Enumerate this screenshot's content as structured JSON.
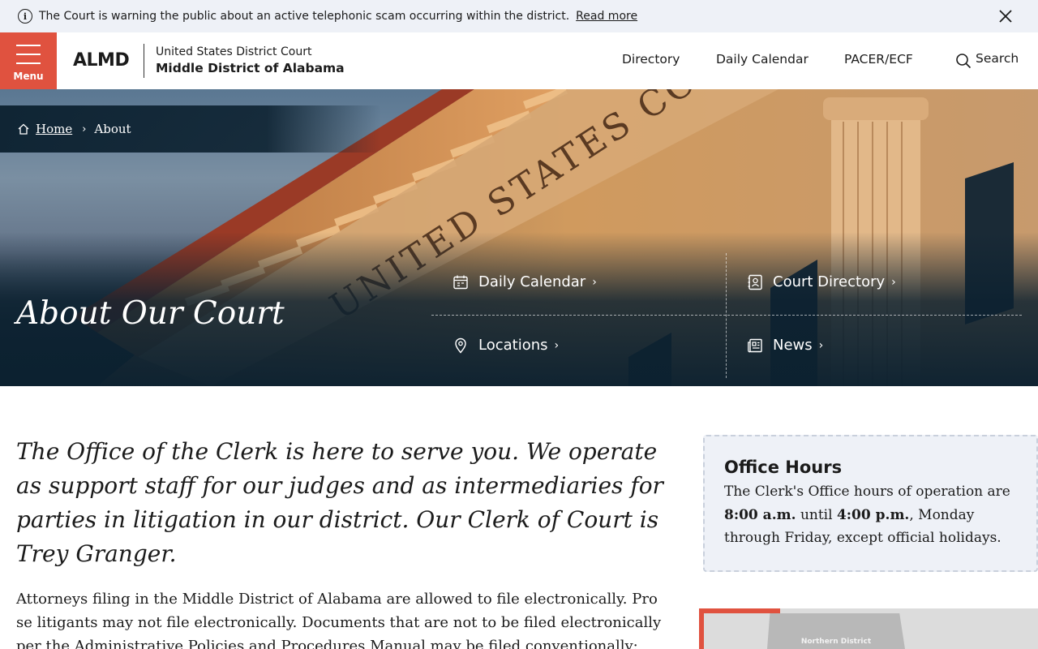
{
  "alert": {
    "message": "The Court is warning the public about an active telephonic scam occurring within the district.",
    "link": "Read more"
  },
  "header": {
    "menu_label": "Menu",
    "logo": "ALMD",
    "court_line1": "United States District Court",
    "court_line2": "Middle District of Alabama",
    "nav": [
      "Directory",
      "Daily Calendar",
      "PACER/ECF"
    ],
    "search_label": "Search"
  },
  "hero": {
    "breadcrumb": {
      "home": "Home",
      "current": "About"
    },
    "title": "About Our Court",
    "building_text": "UNITED STATES COURT HOUSE",
    "quick_links": [
      {
        "label": "Daily Calendar",
        "icon": "calendar-icon"
      },
      {
        "label": "Court Directory",
        "icon": "contact-book-icon"
      },
      {
        "label": "Locations",
        "icon": "map-pin-icon"
      },
      {
        "label": "News",
        "icon": "newspaper-icon"
      }
    ]
  },
  "main": {
    "lead": "The Office of the Clerk is here to serve you. We operate as support staff for our judges and as intermediaries for parties in litigation in our district. Our Clerk of Court is Trey Granger.",
    "body": "Attorneys filing in the Middle District of Alabama are allowed to file electronically. Pro se litigants may not file electronically. Documents that are not to be filed electronically per the Administrative Policies and Procedures Manual may be filed conventionally:"
  },
  "sidebar": {
    "hours_title": "Office Hours",
    "hours_pre": "The Clerk's Office hours of operation are",
    "hours_open": "8:00 a.m.",
    "hours_until": "until",
    "hours_close": "4:00 p.m.",
    "hours_post": ", Monday through Friday, except official holidays.",
    "map_label": "Northern District"
  },
  "colors": {
    "accent": "#e0523f",
    "dark": "#0d2231",
    "panel": "#eef1f7"
  }
}
